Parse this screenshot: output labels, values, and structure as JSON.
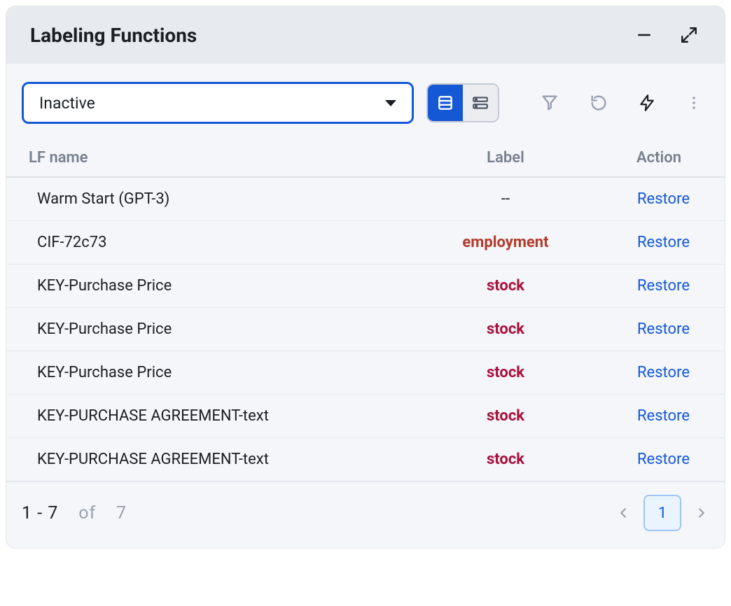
{
  "header": {
    "title": "Labeling Functions"
  },
  "toolbar": {
    "dropdown_value": "Inactive"
  },
  "columns": {
    "name": "LF name",
    "label": "Label",
    "action": "Action"
  },
  "rows": [
    {
      "name": "Warm Start (GPT-3)",
      "label": "--",
      "label_kind": "dash",
      "action": "Restore"
    },
    {
      "name": "CIF-72c73",
      "label": "employment",
      "label_kind": "employment",
      "action": "Restore"
    },
    {
      "name": "KEY-Purchase Price",
      "label": "stock",
      "label_kind": "stock",
      "action": "Restore"
    },
    {
      "name": "KEY-Purchase Price",
      "label": "stock",
      "label_kind": "stock",
      "action": "Restore"
    },
    {
      "name": "KEY-Purchase Price",
      "label": "stock",
      "label_kind": "stock",
      "action": "Restore"
    },
    {
      "name": "KEY-PURCHASE AGREEMENT-text",
      "label": "stock",
      "label_kind": "stock",
      "action": "Restore"
    },
    {
      "name": "KEY-PURCHASE AGREEMENT-text",
      "label": "stock",
      "label_kind": "stock",
      "action": "Restore"
    }
  ],
  "footer": {
    "range_from": "1",
    "range_to": "7",
    "of_word": "of",
    "total": "7",
    "current_page": "1"
  }
}
